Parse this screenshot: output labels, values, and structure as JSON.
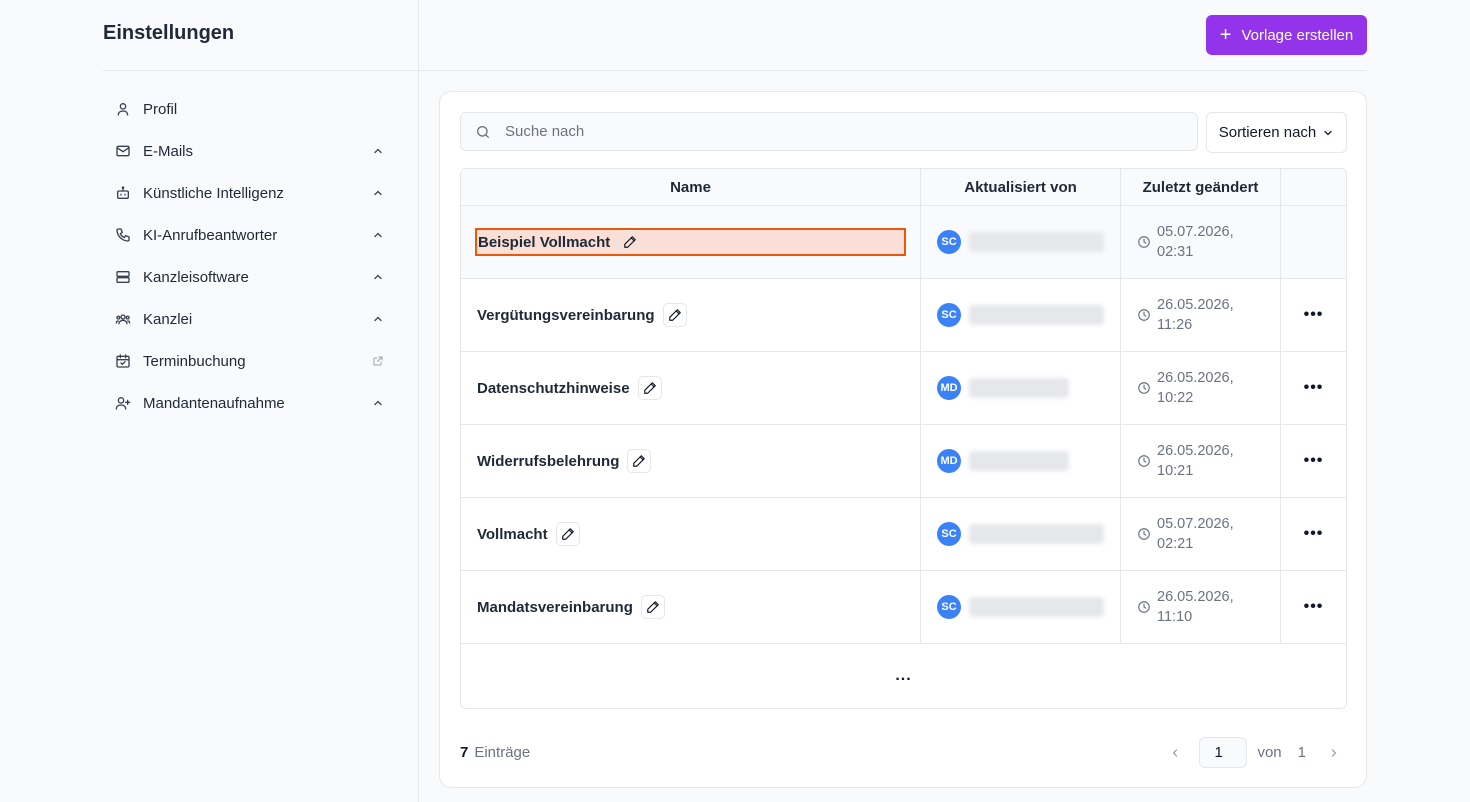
{
  "sidebar": {
    "title": "Einstellungen",
    "items": [
      {
        "label": "Profil",
        "icon": "user-icon",
        "trailing": "none"
      },
      {
        "label": "E-Mails",
        "icon": "mail-icon",
        "trailing": "chevron-up"
      },
      {
        "label": "Künstliche Intelligenz",
        "icon": "bot-icon",
        "trailing": "chevron-up"
      },
      {
        "label": "KI-Anrufbeantworter",
        "icon": "phone-icon",
        "trailing": "chevron-up"
      },
      {
        "label": "Kanzleisoftware",
        "icon": "server-icon",
        "trailing": "chevron-up"
      },
      {
        "label": "Kanzlei",
        "icon": "users-icon",
        "trailing": "chevron-up"
      },
      {
        "label": "Terminbuchung",
        "icon": "calendar-check-icon",
        "trailing": "external-link"
      },
      {
        "label": "Mandantenaufnahme",
        "icon": "user-plus-icon",
        "trailing": "chevron-up"
      }
    ]
  },
  "header": {
    "create_label": "Vorlage erstellen"
  },
  "search": {
    "placeholder": "Suche nach"
  },
  "sort": {
    "label": "Sortieren nach"
  },
  "table": {
    "columns": [
      "Name",
      "Aktualisiert von",
      "Zuletzt geändert",
      ""
    ],
    "rows": [
      {
        "name": "Beispiel Vollmacht",
        "initials": "SC",
        "date": "05.07.2026,",
        "time": "02:31",
        "selected": true,
        "menu": false
      },
      {
        "name": "Vergütungsvereinbarung",
        "initials": "SC",
        "date": "26.05.2026,",
        "time": "11:26",
        "selected": false,
        "menu": true
      },
      {
        "name": "Datenschutzhinweise",
        "initials": "MD",
        "date": "26.05.2026,",
        "time": "10:22",
        "selected": false,
        "menu": true
      },
      {
        "name": "Widerrufsbelehrung",
        "initials": "MD",
        "date": "26.05.2026,",
        "time": "10:21",
        "selected": false,
        "menu": true
      },
      {
        "name": "Vollmacht",
        "initials": "SC",
        "date": "05.07.2026,",
        "time": "02:21",
        "selected": false,
        "menu": true
      },
      {
        "name": "Mandatsvereinbarung",
        "initials": "SC",
        "date": "26.05.2026,",
        "time": "11:10",
        "selected": false,
        "menu": true
      }
    ],
    "more_label": "..."
  },
  "footer": {
    "count": "7",
    "count_label": "Einträge",
    "page": "1",
    "of_label": "von",
    "total_pages": "1"
  },
  "colors": {
    "accent": "#9333ea",
    "avatar": "#3b82f6",
    "selection_border": "#ea580c",
    "selection_fill": "#fadfd6"
  }
}
